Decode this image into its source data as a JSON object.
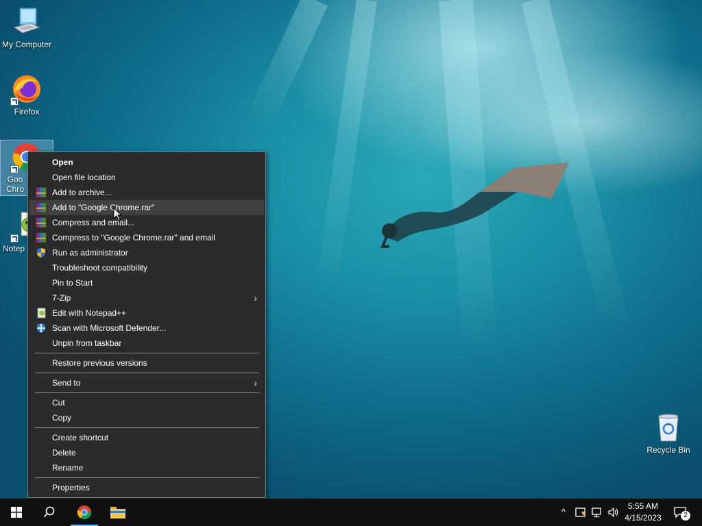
{
  "desktop": {
    "icons": [
      {
        "label": "My Computer"
      },
      {
        "label": "Firefox"
      },
      {
        "label": "Google Chrome",
        "visible_label": "Goo Chro"
      },
      {
        "label": "Notepad++",
        "visible_label": "Notep"
      },
      {
        "label": "Recycle Bin"
      }
    ]
  },
  "context_menu": {
    "items": [
      {
        "label": "Open",
        "icon": ""
      },
      {
        "label": "Open file location",
        "icon": ""
      },
      {
        "label": "Add to archive...",
        "icon": "winrar-icon"
      },
      {
        "label": "Add to \"Google Chrome.rar\"",
        "icon": "winrar-icon"
      },
      {
        "label": "Compress and email...",
        "icon": "winrar-icon"
      },
      {
        "label": "Compress to \"Google Chrome.rar\" and email",
        "icon": "winrar-icon"
      },
      {
        "label": "Run as administrator",
        "icon": "uac-shield-icon"
      },
      {
        "label": "Troubleshoot compatibility",
        "icon": ""
      },
      {
        "label": "Pin to Start",
        "icon": ""
      },
      {
        "label": "7-Zip",
        "icon": "",
        "submenu": true
      },
      {
        "label": "Edit with Notepad++",
        "icon": "notepadpp-icon"
      },
      {
        "label": "Scan with Microsoft Defender...",
        "icon": "defender-icon"
      },
      {
        "label": "Unpin from taskbar",
        "icon": ""
      },
      {
        "label": "Restore previous versions",
        "icon": ""
      },
      {
        "label": "Send to",
        "icon": "",
        "submenu": true
      },
      {
        "label": "Cut",
        "icon": ""
      },
      {
        "label": "Copy",
        "icon": ""
      },
      {
        "label": "Create shortcut",
        "icon": ""
      },
      {
        "label": "Delete",
        "icon": ""
      },
      {
        "label": "Rename",
        "icon": ""
      },
      {
        "label": "Properties",
        "icon": ""
      }
    ],
    "submenu_arrow": "›"
  },
  "taskbar": {
    "pinned": [
      "start-button",
      "search-button",
      "chrome-taskbar-button",
      "file-explorer-taskbar-button"
    ],
    "tray": {
      "chevron": "^",
      "clock_time": "5:55 AM",
      "clock_date": "4/15/2023",
      "notification_count": "2"
    }
  },
  "colors": {
    "menu_bg": "#2b2b2b",
    "menu_hover": "#414141",
    "taskbar_bg": "#101010",
    "accent": "#76b9ed"
  }
}
